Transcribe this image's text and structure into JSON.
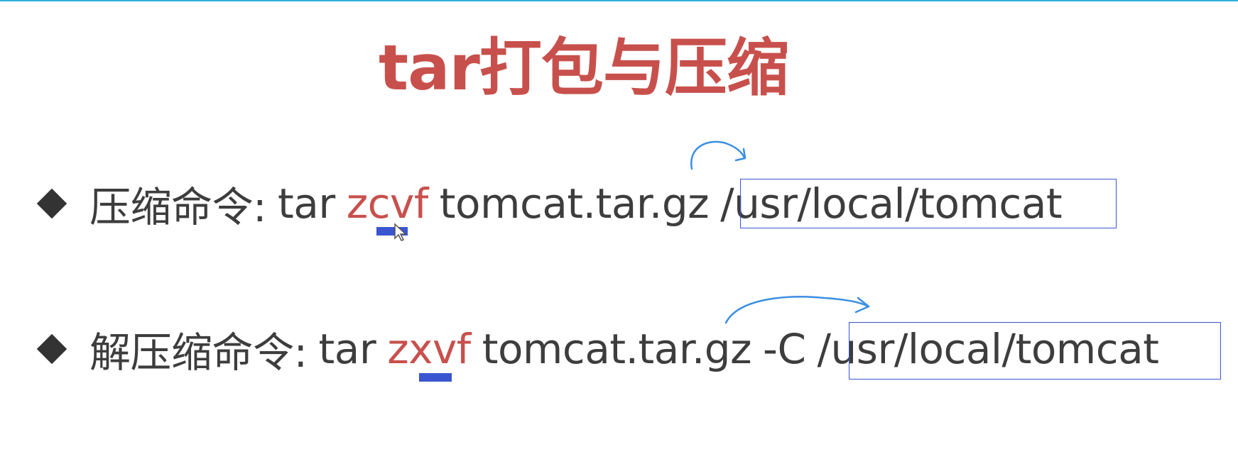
{
  "slide": {
    "title": "tar打包与压缩",
    "accent_color": "#c8504c",
    "annotation_color": "#3a55d0",
    "bullets": [
      {
        "label": "压缩命令:",
        "command_prefix": "tar",
        "flags": "zcvf",
        "archive": "tomcat.tar.gz",
        "option": "",
        "path": "/usr/local/tomcat"
      },
      {
        "label": "解压缩命令:",
        "command_prefix": "tar",
        "flags": "zxvf",
        "archive": "tomcat.tar.gz",
        "option": "-C",
        "path": "/usr/local/tomcat"
      }
    ]
  }
}
